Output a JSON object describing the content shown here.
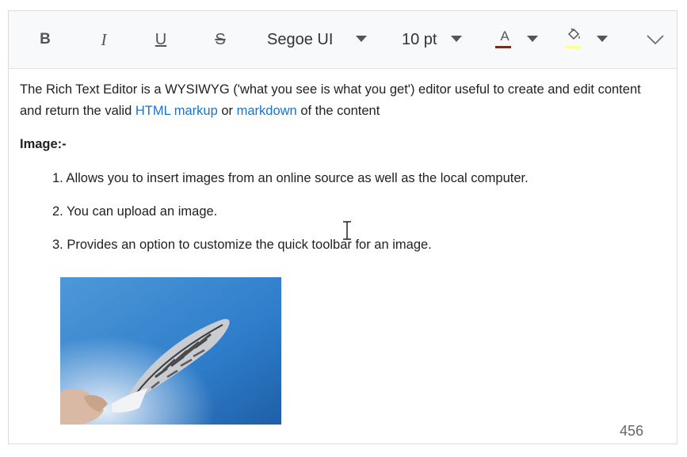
{
  "toolbar": {
    "bold": "B",
    "italic": "I",
    "underline": "U",
    "strikethrough": "S",
    "font_name": "Segoe UI",
    "font_size": "10 pt",
    "font_color_label": "A",
    "font_color": "#7b2a1f",
    "background_color": "#ffff8f",
    "icons": [
      "chevron-down-icon",
      "paint-bucket-icon",
      "expand-chevron-icon"
    ]
  },
  "content": {
    "intro_before_link1": "The Rich Text Editor is a WYSIWYG ('what you see is what you get') editor useful to create and edit content and return the valid ",
    "link1": "HTML markup",
    "between_links": " or ",
    "link2": "markdown",
    "intro_after_link2": " of the content",
    "image_heading": "Image:-",
    "list": [
      "1. Allows you to insert images from an online source as well as the local computer.",
      "2. You can upload an image.",
      "3. Provides an option to customize the quick toolbar for an image."
    ]
  },
  "status": {
    "char_count": "456"
  },
  "colors": {
    "link": "#1a73c9",
    "toolbar_bg": "#f8f9fa",
    "sky": "#2f7ecb"
  }
}
